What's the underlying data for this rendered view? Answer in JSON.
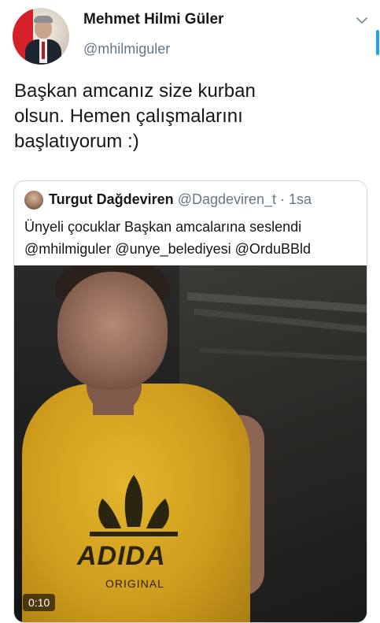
{
  "author": {
    "name": "Mehmet Hilmi Güler",
    "handle": "@mhilmiguler",
    "avatar_icon": "profile-photo"
  },
  "menu_icon": "chevron-down-icon",
  "tweet": {
    "lines": [
      "Başkan amcanız size kurban",
      "olsun. Hemen çalışmalarını",
      "başlatıyorum :)"
    ]
  },
  "quoted_tweet": {
    "name": "Turgut Dağdeviren",
    "handle": "@Dagdeviren_t",
    "separator": " · ",
    "time": "1sa",
    "lines": [
      "Ünyeli çocuklar Başkan amcalarına seslendi",
      "@mhilmiguler @unye_belediyesi @OrduBBld"
    ],
    "video": {
      "duration": "0:10",
      "shirt_print": "ADIDA",
      "shirt_print_sub": "ORIGINAL"
    }
  },
  "colors": {
    "accent": "#1da1f2",
    "secondary_text": "#657786",
    "border": "#ccd6dd"
  }
}
